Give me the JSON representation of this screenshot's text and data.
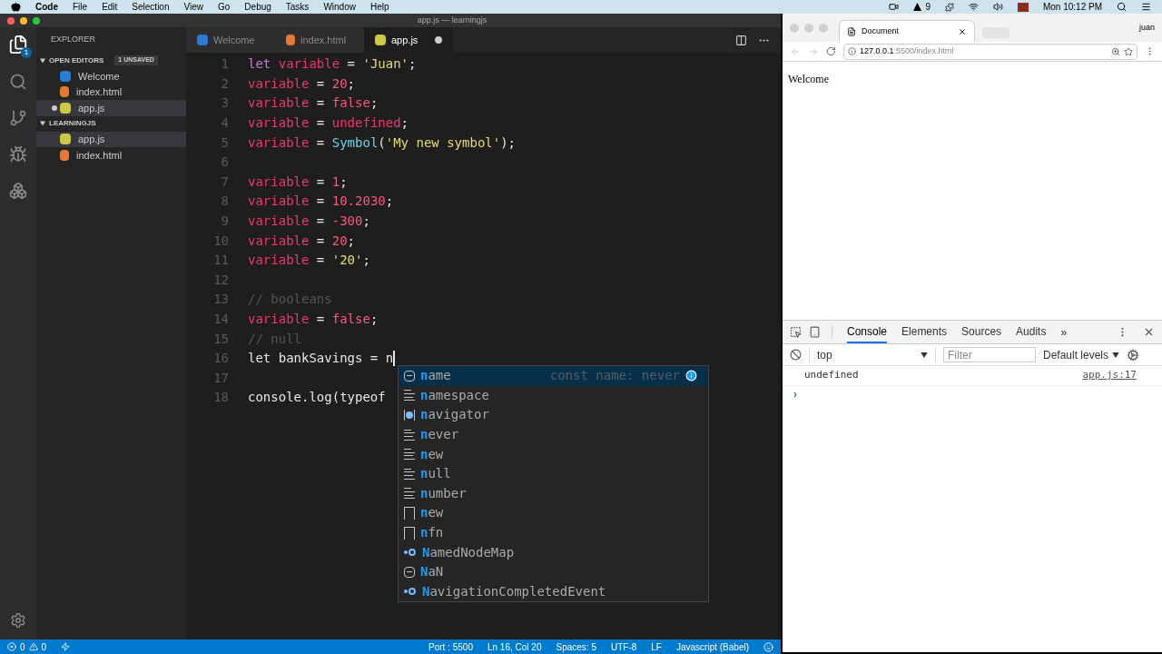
{
  "menubar": {
    "app": "Code",
    "items": [
      "File",
      "Edit",
      "Selection",
      "View",
      "Go",
      "Debug",
      "Tasks",
      "Window",
      "Help"
    ],
    "status_items": [
      "9"
    ],
    "clock": "Mon 10:12 PM"
  },
  "editor_window": {
    "title": "app.js — learningjs",
    "activity_badge": "1",
    "sidebar": {
      "title": "EXPLORER",
      "sections": [
        {
          "title": "OPEN EDITORS",
          "badge": "1 UNSAVED",
          "expanded": true,
          "items": [
            {
              "label": "Welcome",
              "kind": "vscode",
              "dirty": false,
              "selected": false
            },
            {
              "label": "index.html",
              "kind": "html",
              "dirty": false,
              "selected": false
            },
            {
              "label": "app.js",
              "kind": "js",
              "dirty": true,
              "selected": true
            }
          ]
        },
        {
          "title": "LEARNINGJS",
          "expanded": true,
          "items": [
            {
              "label": "app.js",
              "kind": "js",
              "dirty": false,
              "selected": true
            },
            {
              "label": "index.html",
              "kind": "html",
              "dirty": false,
              "selected": false
            }
          ]
        }
      ]
    },
    "tabs": [
      {
        "label": "Welcome",
        "kind": "vscode",
        "selected": false,
        "dirty": false
      },
      {
        "label": "index.html",
        "kind": "html",
        "selected": false,
        "dirty": false
      },
      {
        "label": "app.js",
        "kind": "js",
        "selected": true,
        "dirty": true
      }
    ],
    "lines": [
      {
        "number": "1",
        "tokens": [
          {
            "kind": "keyword",
            "text": "let "
          },
          {
            "kind": "var",
            "text": "variable"
          },
          {
            "kind": "plain",
            "text": " = "
          },
          {
            "kind": "str",
            "text": "'Juan'"
          },
          {
            "kind": "plain",
            "text": ";"
          }
        ]
      },
      {
        "number": "2",
        "tokens": [
          {
            "kind": "var",
            "text": "variable"
          },
          {
            "kind": "plain",
            "text": " = "
          },
          {
            "kind": "num",
            "text": "20"
          },
          {
            "kind": "plain",
            "text": ";"
          }
        ]
      },
      {
        "number": "3",
        "tokens": [
          {
            "kind": "var",
            "text": "variable"
          },
          {
            "kind": "plain",
            "text": " = "
          },
          {
            "kind": "num",
            "text": "false"
          },
          {
            "kind": "plain",
            "text": ";"
          }
        ]
      },
      {
        "number": "4",
        "tokens": [
          {
            "kind": "var",
            "text": "variable"
          },
          {
            "kind": "plain",
            "text": " = "
          },
          {
            "kind": "var",
            "text": "undefined"
          },
          {
            "kind": "plain",
            "text": ";"
          }
        ]
      },
      {
        "number": "5",
        "tokens": [
          {
            "kind": "var",
            "text": "variable"
          },
          {
            "kind": "plain",
            "text": " = "
          },
          {
            "kind": "fn",
            "text": "Symbol"
          },
          {
            "kind": "plain",
            "text": "("
          },
          {
            "kind": "str",
            "text": "'My new symbol'"
          },
          {
            "kind": "plain",
            "text": ");"
          }
        ]
      },
      {
        "number": "6"
      },
      {
        "number": "7",
        "tokens": [
          {
            "kind": "var",
            "text": "variable"
          },
          {
            "kind": "plain",
            "text": " = "
          },
          {
            "kind": "num",
            "text": "1"
          },
          {
            "kind": "plain",
            "text": ";"
          }
        ]
      },
      {
        "number": "8",
        "tokens": [
          {
            "kind": "var",
            "text": "variable"
          },
          {
            "kind": "plain",
            "text": " = "
          },
          {
            "kind": "num",
            "text": "10.2030"
          },
          {
            "kind": "plain",
            "text": ";"
          }
        ]
      },
      {
        "number": "9",
        "tokens": [
          {
            "kind": "var",
            "text": "variable"
          },
          {
            "kind": "plain",
            "text": " = "
          },
          {
            "kind": "num",
            "text": "-300"
          },
          {
            "kind": "plain",
            "text": ";"
          }
        ]
      },
      {
        "number": "10",
        "tokens": [
          {
            "kind": "var",
            "text": "variable"
          },
          {
            "kind": "plain",
            "text": " = "
          },
          {
            "kind": "num",
            "text": "20"
          },
          {
            "kind": "plain",
            "text": ";"
          }
        ]
      },
      {
        "number": "11",
        "tokens": [
          {
            "kind": "var",
            "text": "variable"
          },
          {
            "kind": "plain",
            "text": " = "
          },
          {
            "kind": "str",
            "text": "'20'"
          },
          {
            "kind": "plain",
            "text": ";"
          }
        ]
      },
      {
        "number": "12"
      },
      {
        "number": "13",
        "tokens": [
          {
            "kind": "comment",
            "text": "// booleans"
          }
        ]
      },
      {
        "number": "14",
        "tokens": [
          {
            "kind": "var",
            "text": "variable"
          },
          {
            "kind": "plain",
            "text": " = "
          },
          {
            "kind": "num",
            "text": "false"
          },
          {
            "kind": "plain",
            "text": ";"
          }
        ]
      },
      {
        "number": "15",
        "tokens": [
          {
            "kind": "comment",
            "text": "// null"
          }
        ]
      },
      {
        "number": "16",
        "tokens": [
          {
            "kind": "plain",
            "text": "let bankSavings = n"
          }
        ],
        "cursor": true
      },
      {
        "number": "17"
      },
      {
        "number": "18",
        "tokens": [
          {
            "kind": "plain",
            "text": "console.log(typeof"
          }
        ]
      }
    ],
    "suggestions": [
      {
        "match": "n",
        "rest": "ame",
        "kind": "value",
        "selected": true,
        "detail": "const name: never"
      },
      {
        "match": "n",
        "rest": "amespace",
        "kind": "snippet",
        "selected": false
      },
      {
        "match": "n",
        "rest": "avigator",
        "kind": "module",
        "selected": false
      },
      {
        "match": "n",
        "rest": "ever",
        "kind": "snippet",
        "selected": false
      },
      {
        "match": "n",
        "rest": "ew",
        "kind": "snippet",
        "selected": false
      },
      {
        "match": "n",
        "rest": "ull",
        "kind": "snippet",
        "selected": false
      },
      {
        "match": "n",
        "rest": "umber",
        "kind": "snippet",
        "selected": false
      },
      {
        "match": "n",
        "rest": "ew",
        "kind": "text",
        "selected": false
      },
      {
        "match": "n",
        "rest": "fn",
        "kind": "text",
        "selected": false
      },
      {
        "match": "N",
        "rest": "amedNodeMap",
        "kind": "interface",
        "selected": false
      },
      {
        "match": "N",
        "rest": "aN",
        "kind": "value",
        "selected": false
      },
      {
        "match": "N",
        "rest": "avigationCompletedEvent",
        "kind": "interface",
        "selected": false
      }
    ],
    "status_bar": {
      "errors": "0",
      "warnings": "0",
      "items": [
        "Port : 5500",
        "Ln 16, Col 20",
        "Spaces: 5",
        "UTF-8",
        "LF",
        "Javascript (Babel)"
      ]
    }
  },
  "browser": {
    "tab": "Document",
    "user": "juan",
    "url_host": "127.0.0.1",
    "url_rest": ":5500/index.html",
    "page_text": "Welcome",
    "devtools": {
      "tabs": [
        {
          "label": "Console",
          "selected": true
        },
        {
          "label": "Elements",
          "selected": false
        },
        {
          "label": "Sources",
          "selected": false
        },
        {
          "label": "Audits",
          "selected": false
        }
      ],
      "more": "»",
      "context": "top",
      "filter_placeholder": "Filter",
      "levels": "Default levels",
      "messages": [
        {
          "text": "undefined",
          "source": "app.js:17"
        }
      ],
      "prompt": "›"
    }
  }
}
